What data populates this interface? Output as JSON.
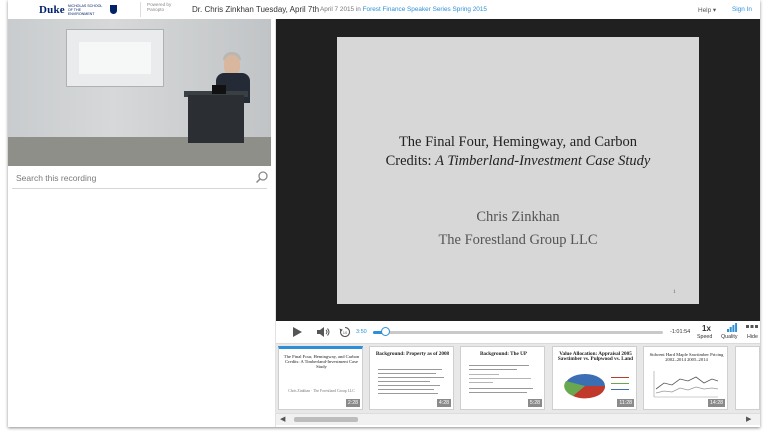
{
  "header": {
    "logo_word": "Duke",
    "logo_sub": "Nicholas School of the Environment",
    "powered_by": "Powered by Panopto",
    "session_title": "Dr. Chris Zinkhan Tuesday, April 7th",
    "date_prefix": "April 7 2015 in",
    "folder_link": "Forest Finance Speaker Series Spring 2015",
    "help_label": "Help ▾",
    "signin_label": "Sign In"
  },
  "search": {
    "placeholder": "Search this recording",
    "value": ""
  },
  "slide": {
    "title_line1": "The Final Four, Hemingway, and Carbon",
    "title_line2_plain": "Credits: ",
    "title_line2_italic": "A Timberland-Investment Case Study",
    "author": "Chris Zinkhan",
    "org": "The Forestland Group LLC",
    "page_number": "1"
  },
  "player": {
    "current_time": "3:50",
    "remaining_time": "-1:01:54",
    "progress": 0.04,
    "speed_value": "1x",
    "speed_label": "Speed",
    "quality_label": "Quality",
    "hide_label": "Hide"
  },
  "thumbnails": [
    {
      "title": "The Final Four, Hemingway, and Carbon Credits: A Timberland-Investment Case Study",
      "sub": "Chris Zinkhan · The Forestland Group LLC",
      "time": "2:28",
      "active": true
    },
    {
      "title": "Background: Property as of 2008",
      "time": "4:28",
      "active": false
    },
    {
      "title": "Background: The UP",
      "time": "5:28",
      "active": false
    },
    {
      "title": "Value Allocation: Appraisal 2005 Sawtimber vs. Pulpwood vs. Land",
      "time": "11:28",
      "active": false
    },
    {
      "title": "Stdwent Hard Maple Sawtimber Pricing 2002–2014 2005–2014",
      "time": "14:28",
      "active": false
    }
  ],
  "colors": {
    "accent": "#2e8fd6",
    "duke_navy": "#012169",
    "viewer_bg": "#202020",
    "slide_bg": "#d7d7d7"
  },
  "icons": [
    "play-icon",
    "volume-icon",
    "rewind-icon",
    "quality-icon",
    "hide-icon",
    "search-icon"
  ]
}
